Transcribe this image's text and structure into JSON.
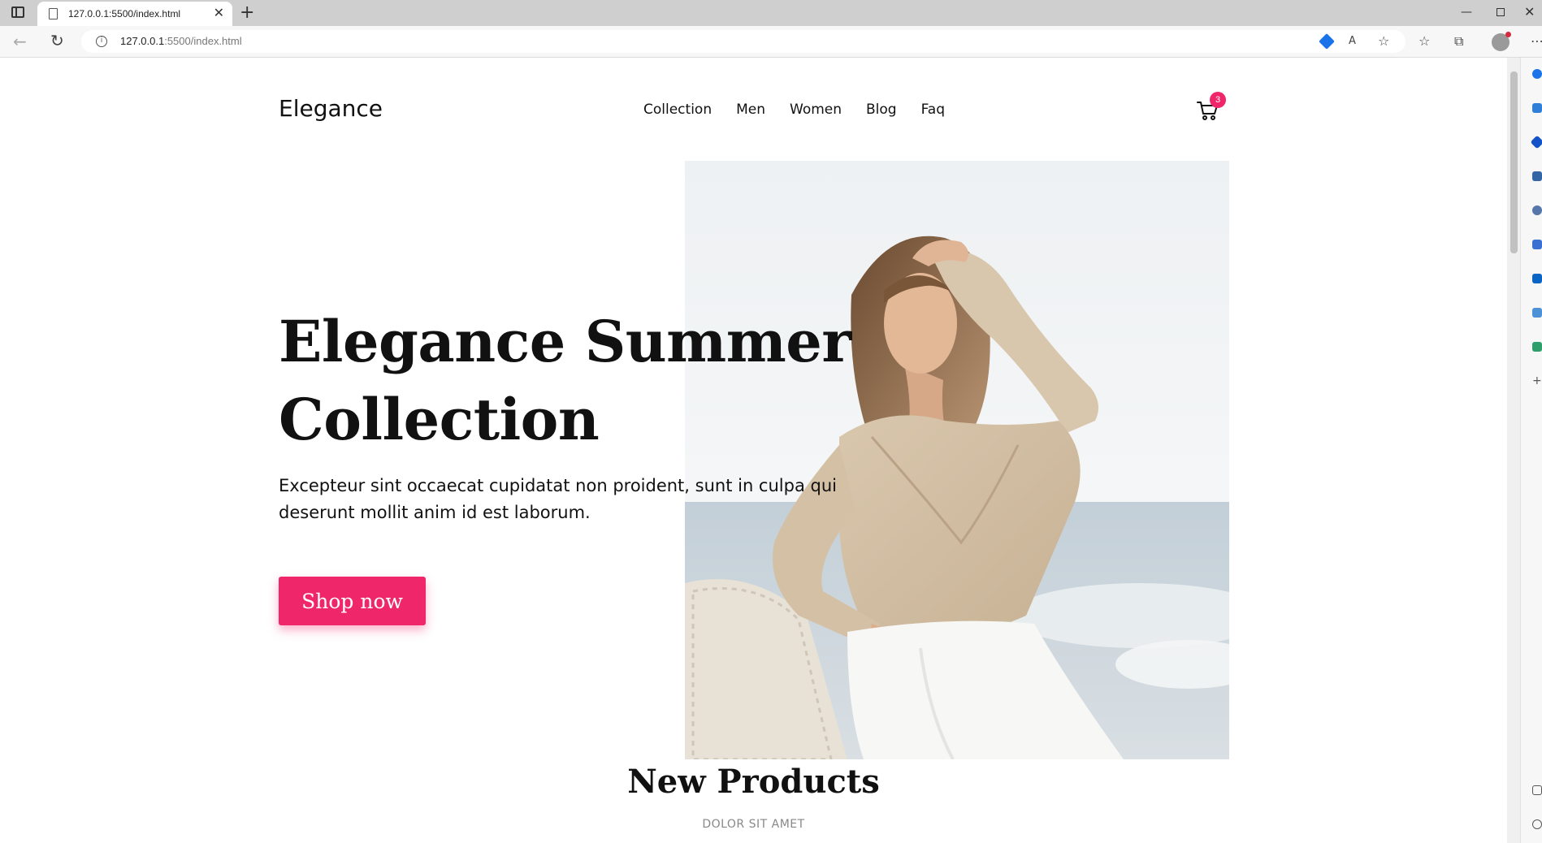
{
  "browser": {
    "tab_title": "127.0.0.1:5500/index.html",
    "url_host": "127.0.0.1",
    "url_path": ":5500/index.html"
  },
  "site": {
    "logo": "Elegance",
    "nav": [
      "Collection",
      "Men",
      "Women",
      "Blog",
      "Faq"
    ],
    "cart_count": "3"
  },
  "hero": {
    "title_line1": "Elegance Summer",
    "title_line2": "Collection",
    "text_line1": "Excepteur sint occaecat cupidatat non proident, sunt in culpa qui",
    "text_line2": "deserunt mollit anim id est laborum.",
    "button": "Shop now"
  },
  "products": {
    "title": "New Products",
    "subtitle": "DOLOR SIT AMET"
  },
  "colors": {
    "accent": "#f0266b",
    "text": "#111111"
  }
}
